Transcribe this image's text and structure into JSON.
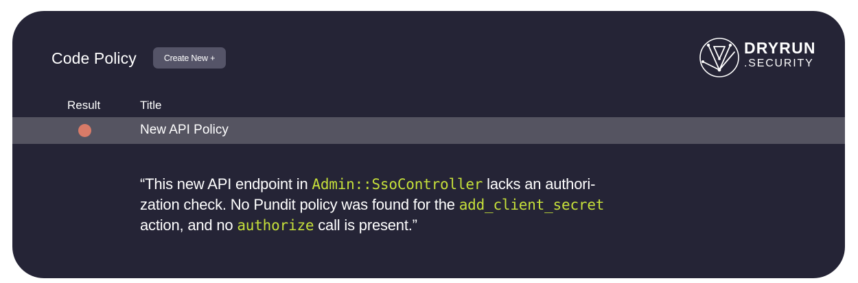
{
  "header": {
    "title": "Code Policy",
    "create_label": "Create New +"
  },
  "logo": {
    "top": "DRYRUN",
    "bottom": ".SECURITY"
  },
  "table": {
    "columns": [
      "Result",
      "Title"
    ],
    "rows": [
      {
        "result_status": "fail",
        "result_color": "#d97b68",
        "title": "New API Policy"
      }
    ]
  },
  "finding": {
    "l1_a": "“This new API endpoint in ",
    "l1_code": "Admin::SsoController",
    "l1_b": " lacks an authori-",
    "l2_a": "zation check. No Pundit policy was found for the ",
    "l2_code": "add_client_secret",
    "l3_a": "action, and no ",
    "l3_code": "authorize",
    "l3_b": " call is present.”"
  },
  "colors": {
    "background": "#252436",
    "row_highlight": "#555461",
    "button": "#555468",
    "code": "#c6e03a"
  }
}
